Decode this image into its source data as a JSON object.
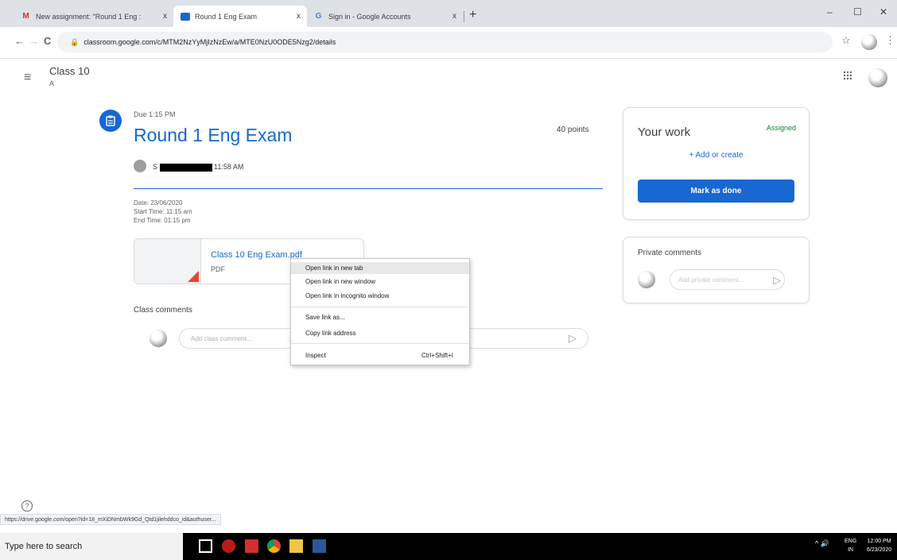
{
  "browser": {
    "tabs": [
      {
        "favicon": "gmail-icon",
        "title": "New assignment: \"Round 1 Eng :",
        "close": "x"
      },
      {
        "favicon": "classroom-icon",
        "title": "Round 1 Eng Exam",
        "close": "x"
      },
      {
        "favicon": "google-icon",
        "title": "Sign in - Google Accounts",
        "close": "x"
      }
    ],
    "new_tab": "+",
    "window_controls": {
      "minimize": "–",
      "maximize": "☐",
      "close": "✕"
    },
    "url": "classroom.google.com/c/MTM2NzYyMjIzNzEw/a/MTE0NzU0ODE5Nzg2/details",
    "nav": {
      "back": "←",
      "forward": "→",
      "reload": "C"
    },
    "star": "☆",
    "menu": "⋮"
  },
  "classroom": {
    "menu_icon": "≡",
    "class_name": "Class 10",
    "section": "A",
    "apps_icon": "⋮⋮⋮"
  },
  "assignment": {
    "icon": "📋",
    "due": "Due 1:15 PM",
    "title": "Round 1 Eng Exam",
    "points": "40 points",
    "author_initial": "S",
    "posted_time": "11:58 AM",
    "details": [
      "Date: 23/06/2020",
      "Start Time: 11:15 am",
      "End Time: 01:15 pm"
    ],
    "attachment": {
      "name": "Class 10 Eng Exam.pdf",
      "type": "PDF"
    }
  },
  "class_comments": {
    "label": "Class comments",
    "placeholder": "Add class comment...",
    "send_icon": "▷"
  },
  "your_work": {
    "title": "Your work",
    "status": "Assigned",
    "add_create": "+  Add or create",
    "mark_done": "Mark as done"
  },
  "private_comments": {
    "title": "Private comments",
    "placeholder": "Add private comment...",
    "send_icon": "▷"
  },
  "context_menu": {
    "items": [
      {
        "label": "Open link in new tab",
        "shortcut": ""
      },
      {
        "label": "Open link in new window",
        "shortcut": ""
      },
      {
        "label": "Open link in incognito window",
        "shortcut": ""
      },
      {
        "label": "Save link as...",
        "shortcut": ""
      },
      {
        "label": "Copy link address",
        "shortcut": ""
      },
      {
        "label": "Inspect",
        "shortcut": "Ctrl+Shift+I"
      }
    ]
  },
  "help_icon": "?",
  "status_url": "https://drive.google.com/open?id=18_mXiDNmbWk9Gd_Qtd1jilehddco_id&authuser...",
  "taskbar": {
    "search": "Type here to search",
    "lang_top": "ENG",
    "lang_bottom": "IN",
    "time": "12:00 PM",
    "date": "6/23/2020",
    "tray": "^  🔊"
  },
  "colors": {
    "accent": "#1967d2",
    "assigned": "#188038",
    "pdf": "#ea4335"
  }
}
